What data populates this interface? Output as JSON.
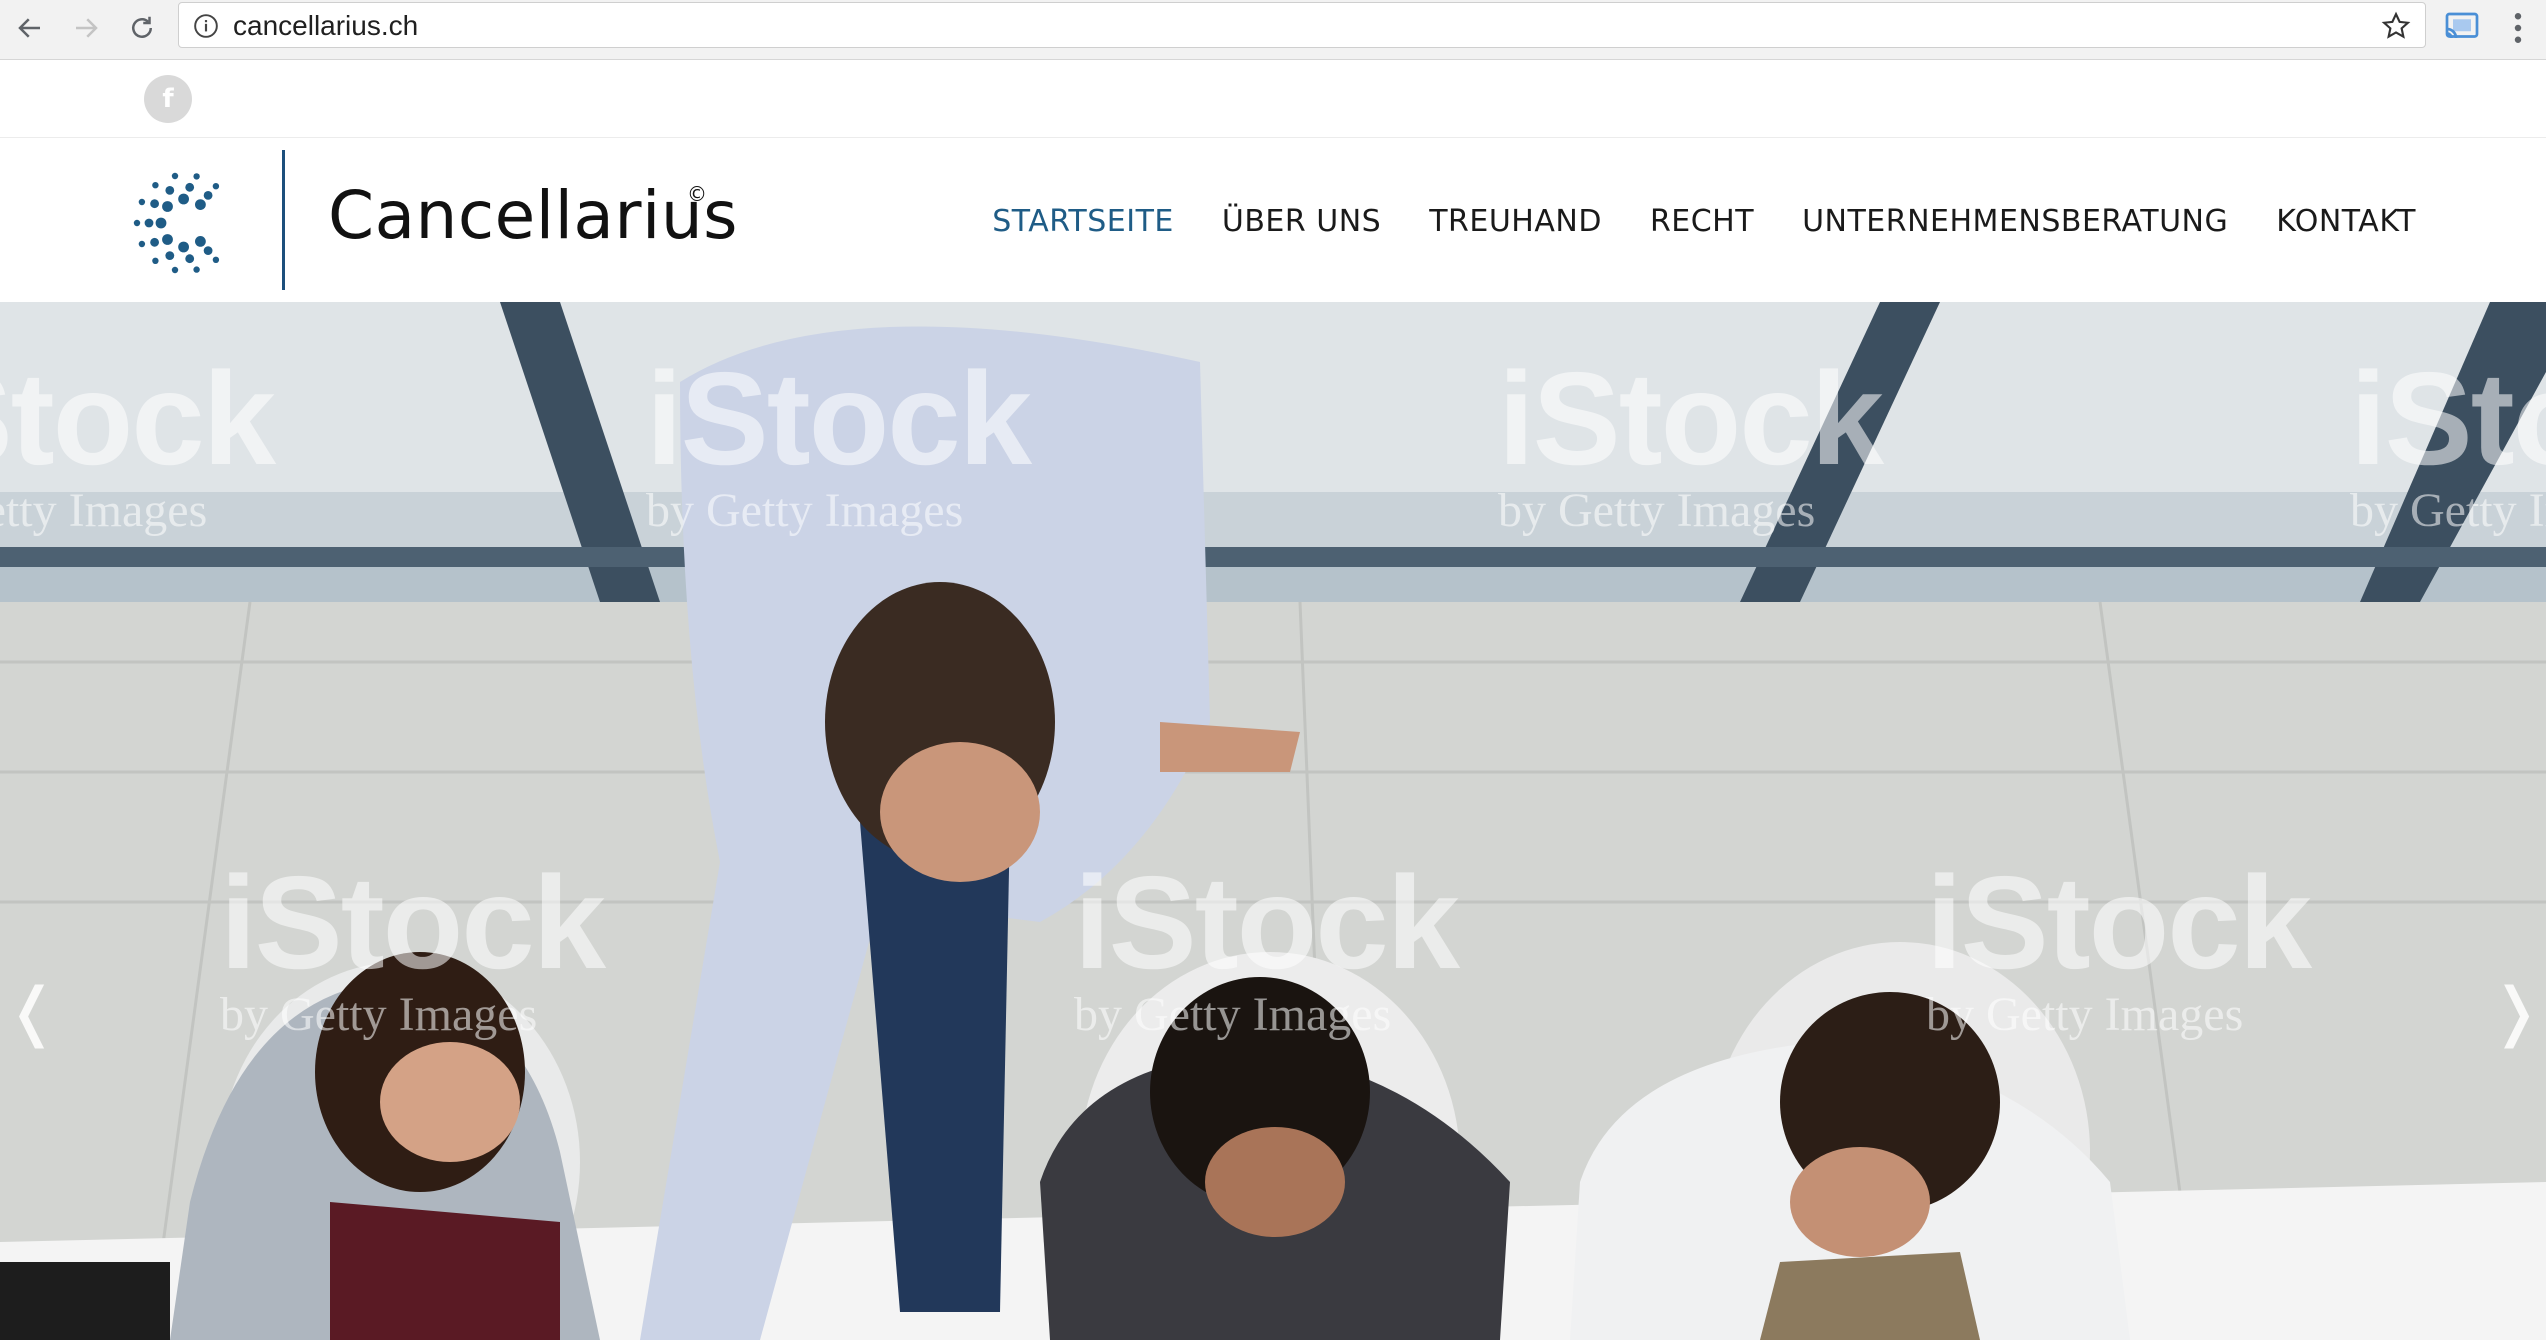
{
  "browser": {
    "url": "cancellarius.ch",
    "icons": [
      "back-arrow-icon",
      "forward-arrow-icon",
      "reload-icon",
      "info-icon",
      "star-icon",
      "cast-icon",
      "kebab-menu-icon"
    ]
  },
  "social": {
    "facebook_glyph": "f"
  },
  "brand": {
    "name": "Cancellarius",
    "copyright_mark": "©",
    "accent_color": "#1f5c86"
  },
  "nav": {
    "items": [
      {
        "label": "STARTSEITE",
        "active": true
      },
      {
        "label": "ÜBER UNS",
        "active": false
      },
      {
        "label": "TREUHAND",
        "active": false
      },
      {
        "label": "RECHT",
        "active": false
      },
      {
        "label": "UNTERNEHMENSBERATUNG",
        "active": false
      },
      {
        "label": "KONTAKT",
        "active": false
      }
    ]
  },
  "hero": {
    "watermark_brand": "iStock",
    "watermark_sub": "by Getty Images",
    "prev_arrow": "❬",
    "next_arrow": "❭"
  }
}
